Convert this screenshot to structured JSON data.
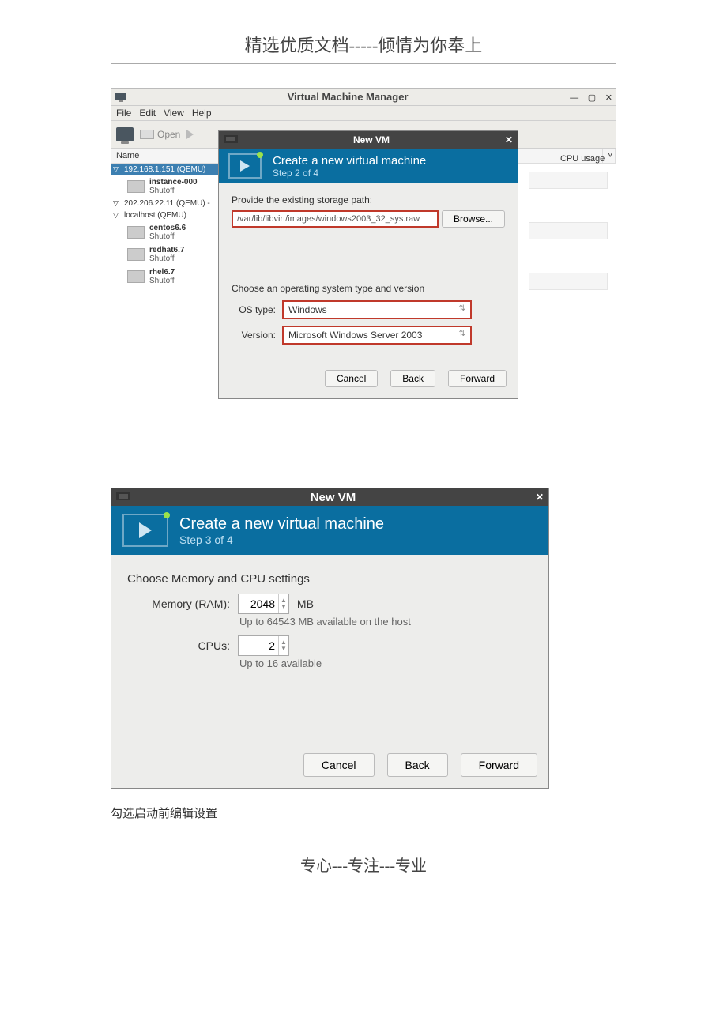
{
  "page": {
    "header": "精选优质文档-----倾情为你奉上",
    "footer": "专心---专注---专业",
    "caption": "勾选启动前编辑设置"
  },
  "vmm": {
    "title": "Virtual Machine Manager",
    "menu": {
      "file": "File",
      "edit": "Edit",
      "view": "View",
      "help": "Help"
    },
    "toolbar": {
      "open": "Open"
    },
    "columns": {
      "name": "Name",
      "cpu": "CPU usage"
    },
    "connections": [
      {
        "label": "192.168.1.151 (QEMU)",
        "highlighted": true
      },
      {
        "label": "202.206.22.11 (QEMU) -",
        "highlighted": false
      },
      {
        "label": "localhost (QEMU)",
        "highlighted": false
      }
    ],
    "vms_conn0": [
      {
        "name": "instance-000",
        "state": "Shutoff"
      }
    ],
    "vms_conn2": [
      {
        "name": "centos6.6",
        "state": "Shutoff"
      },
      {
        "name": "redhat6.7",
        "state": "Shutoff"
      },
      {
        "name": "rhel6.7",
        "state": "Shutoff"
      }
    ]
  },
  "step2": {
    "title": "New VM",
    "banner_title": "Create a new virtual machine",
    "banner_step": "Step 2 of 4",
    "path_label": "Provide the existing storage path:",
    "path_value": "/var/lib/libvirt/images/windows2003_32_sys.raw",
    "browse": "Browse...",
    "choose_label": "Choose an operating system type and version",
    "ostype_label": "OS type:",
    "ostype_value": "Windows",
    "version_label": "Version:",
    "version_value": "Microsoft Windows Server 2003",
    "cancel": "Cancel",
    "back": "Back",
    "forward": "Forward"
  },
  "step3": {
    "title": "New VM",
    "banner_title": "Create a new virtual machine",
    "banner_step": "Step 3 of 4",
    "heading": "Choose Memory and CPU settings",
    "mem_label": "Memory (RAM):",
    "mem_value": "2048",
    "mem_unit": "MB",
    "mem_hint": "Up to 64543 MB available on the host",
    "cpu_label": "CPUs:",
    "cpu_value": "2",
    "cpu_hint": "Up to 16 available",
    "cancel": "Cancel",
    "back": "Back",
    "forward": "Forward"
  }
}
